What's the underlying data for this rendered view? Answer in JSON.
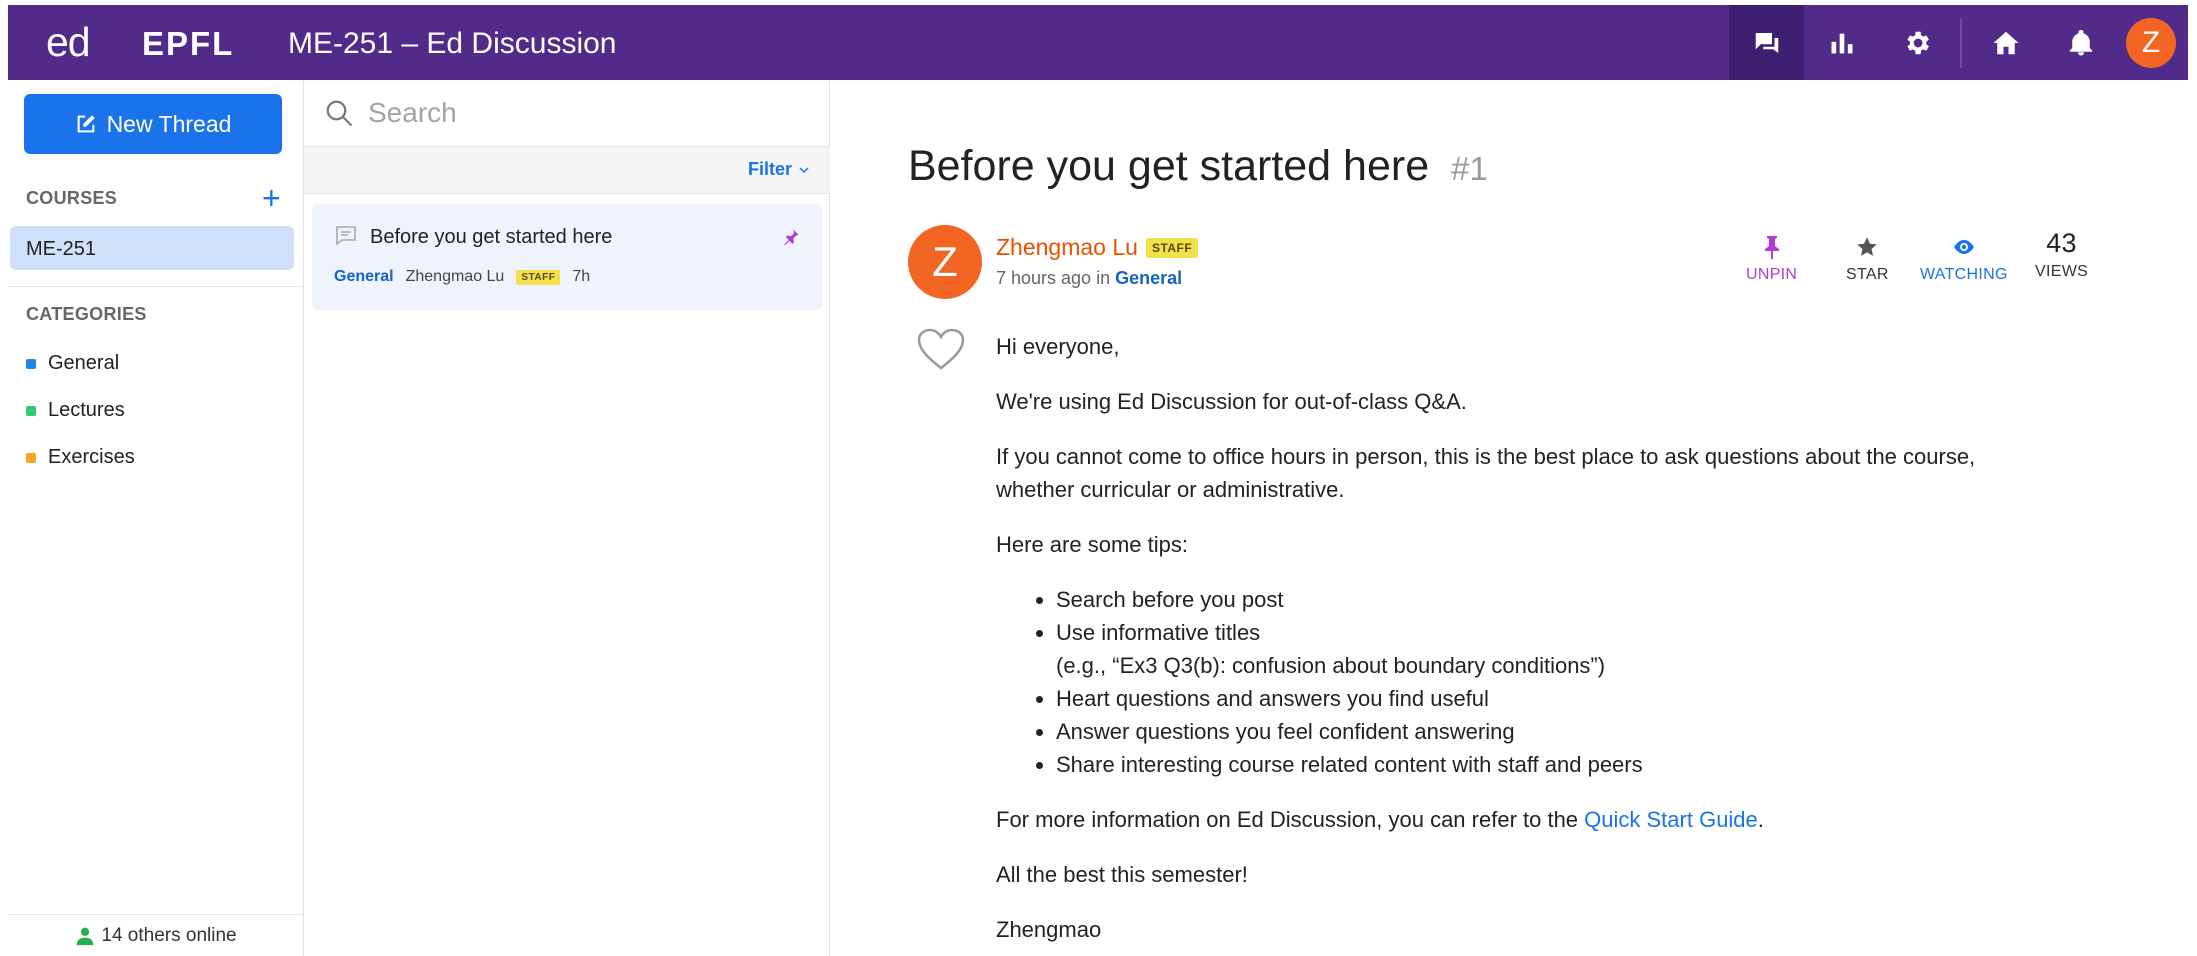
{
  "header": {
    "logo_ed": "ed",
    "logo_epfl": "EPFL",
    "title": "ME-251 – Ed Discussion",
    "avatar_letter": "Z",
    "nav_icons": [
      "discussion-icon",
      "analytics-icon",
      "settings-icon",
      "home-icon",
      "bell-icon"
    ]
  },
  "sidebar": {
    "new_thread_label": "New Thread",
    "courses_label": "COURSES",
    "courses": [
      {
        "label": "ME-251",
        "selected": true
      }
    ],
    "categories_label": "CATEGORIES",
    "categories": [
      {
        "label": "General",
        "color": "#1e88e5"
      },
      {
        "label": "Lectures",
        "color": "#2ecc71"
      },
      {
        "label": "Exercises",
        "color": "#f5a623"
      }
    ],
    "online_text": "14 others online"
  },
  "threadlist": {
    "search_placeholder": "Search",
    "filter_label": "Filter",
    "threads": [
      {
        "title": "Before you get started here",
        "category": "General",
        "author": "Zhengmao Lu",
        "badge": "STAFF",
        "time": "7h",
        "pinned": true
      }
    ]
  },
  "post": {
    "title": "Before you get started here",
    "number": "#1",
    "author": {
      "initial": "Z",
      "name": "Zhengmao Lu",
      "badge": "STAFF",
      "time": "7 hours ago",
      "in_label": "in",
      "category": "General"
    },
    "actions": {
      "unpin": "UNPIN",
      "star": "STAR",
      "watching": "WATCHING",
      "views_count": "43",
      "views_label": "VIEWS"
    },
    "body": {
      "greeting": "Hi everyone,",
      "p1": "We're using Ed Discussion for out-of-class Q&A.",
      "p2_line1": "If you cannot come to office hours in person, this is the best place to ask questions about the course,",
      "p2_line2": "whether curricular or administrative.",
      "p3": "Here are some tips:",
      "tips": [
        "Search before you post",
        "Use informative titles",
        "Heart questions and answers you find useful",
        "Answer questions you feel confident answering",
        "Share interesting course related content with staff and peers"
      ],
      "tip2_example": "(e.g., “Ex3 Q3(b): confusion about boundary conditions”)",
      "more_info_prefix": "For more information on Ed Discussion, you can refer to the ",
      "more_info_link": "Quick Start Guide",
      "more_info_suffix": ".",
      "closing": "All the best this semester!",
      "signature": "Zhengmao"
    }
  }
}
